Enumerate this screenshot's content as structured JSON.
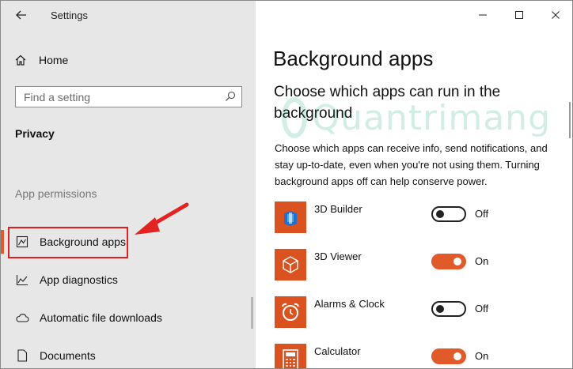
{
  "window": {
    "app_title": "Settings",
    "controls": [
      "minimize",
      "maximize",
      "close"
    ]
  },
  "sidebar": {
    "home_label": "Home",
    "search_placeholder": "Find a setting",
    "section_title": "Privacy",
    "group_label": "App permissions",
    "items": [
      {
        "label": "Background apps",
        "icon": "background-apps-icon",
        "selected": true
      },
      {
        "label": "App diagnostics",
        "icon": "diagnostics-icon",
        "selected": false
      },
      {
        "label": "Automatic file downloads",
        "icon": "cloud-icon",
        "selected": false
      },
      {
        "label": "Documents",
        "icon": "document-icon",
        "selected": false
      }
    ]
  },
  "main": {
    "title": "Background apps",
    "subheading": "Choose which apps can run in the background",
    "description": "Choose which apps can receive info, send notifications, and stay up-to-date, even when you're not using them. Turning background apps off can help conserve power.",
    "apps": [
      {
        "name": "3D Builder",
        "state": "Off",
        "on": false,
        "icon": "3d-builder-icon"
      },
      {
        "name": "3D Viewer",
        "state": "On",
        "on": true,
        "icon": "3d-viewer-icon"
      },
      {
        "name": "Alarms & Clock",
        "state": "Off",
        "on": false,
        "icon": "alarm-clock-icon"
      },
      {
        "name": "Calculator",
        "state": "On",
        "on": true,
        "icon": "calculator-icon"
      }
    ]
  },
  "colors": {
    "accent": "#e05a2a",
    "tile": "#d9521f",
    "sidebar_bg": "#e7e7e7",
    "highlight": "#e02020"
  },
  "watermark": "Quantrimang"
}
